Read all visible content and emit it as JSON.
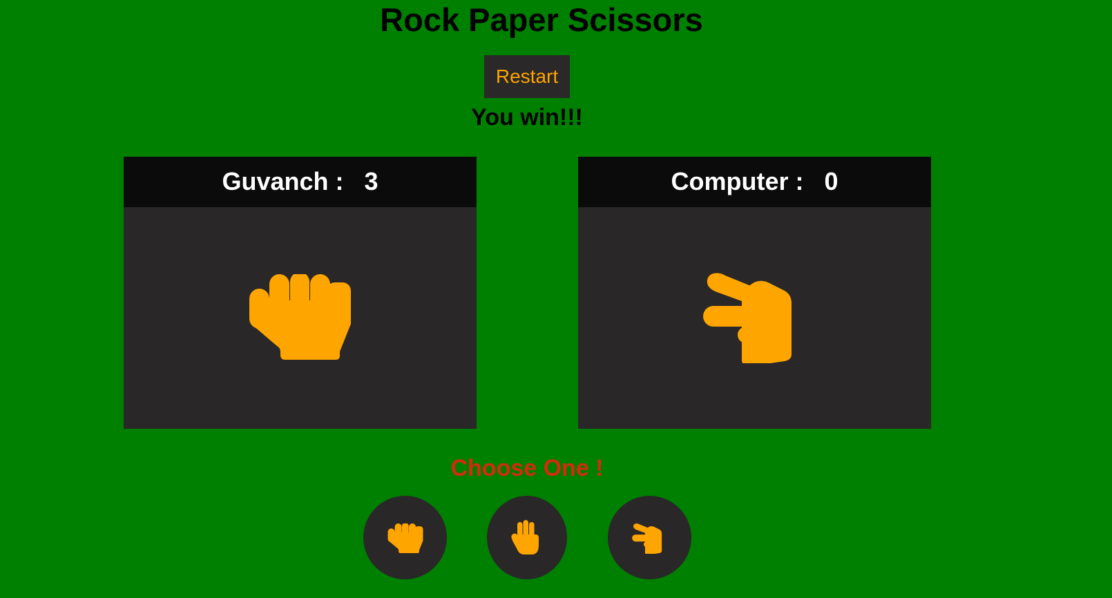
{
  "header": {
    "title": "Rock Paper Scissors",
    "restart_label": "Restart",
    "result_text": "You win!!!"
  },
  "player": {
    "label": "Guvanch :   3",
    "name": "Guvanch",
    "score": 3,
    "hand_icon": "rock-fist-icon"
  },
  "computer": {
    "label": "Computer :   0",
    "name": "Computer",
    "score": 0,
    "hand_icon": "scissors-hand-icon"
  },
  "chooser": {
    "prompt": "Choose One !",
    "options": [
      {
        "icon": "rock-fist-icon"
      },
      {
        "icon": "paper-hand-icon"
      },
      {
        "icon": "scissors-hand-icon"
      }
    ]
  },
  "colors": {
    "background": "#008000",
    "panel": "#292728",
    "panel_header": "#0b0b0b",
    "accent": "#ffa500",
    "prompt": "#d62a0e"
  }
}
